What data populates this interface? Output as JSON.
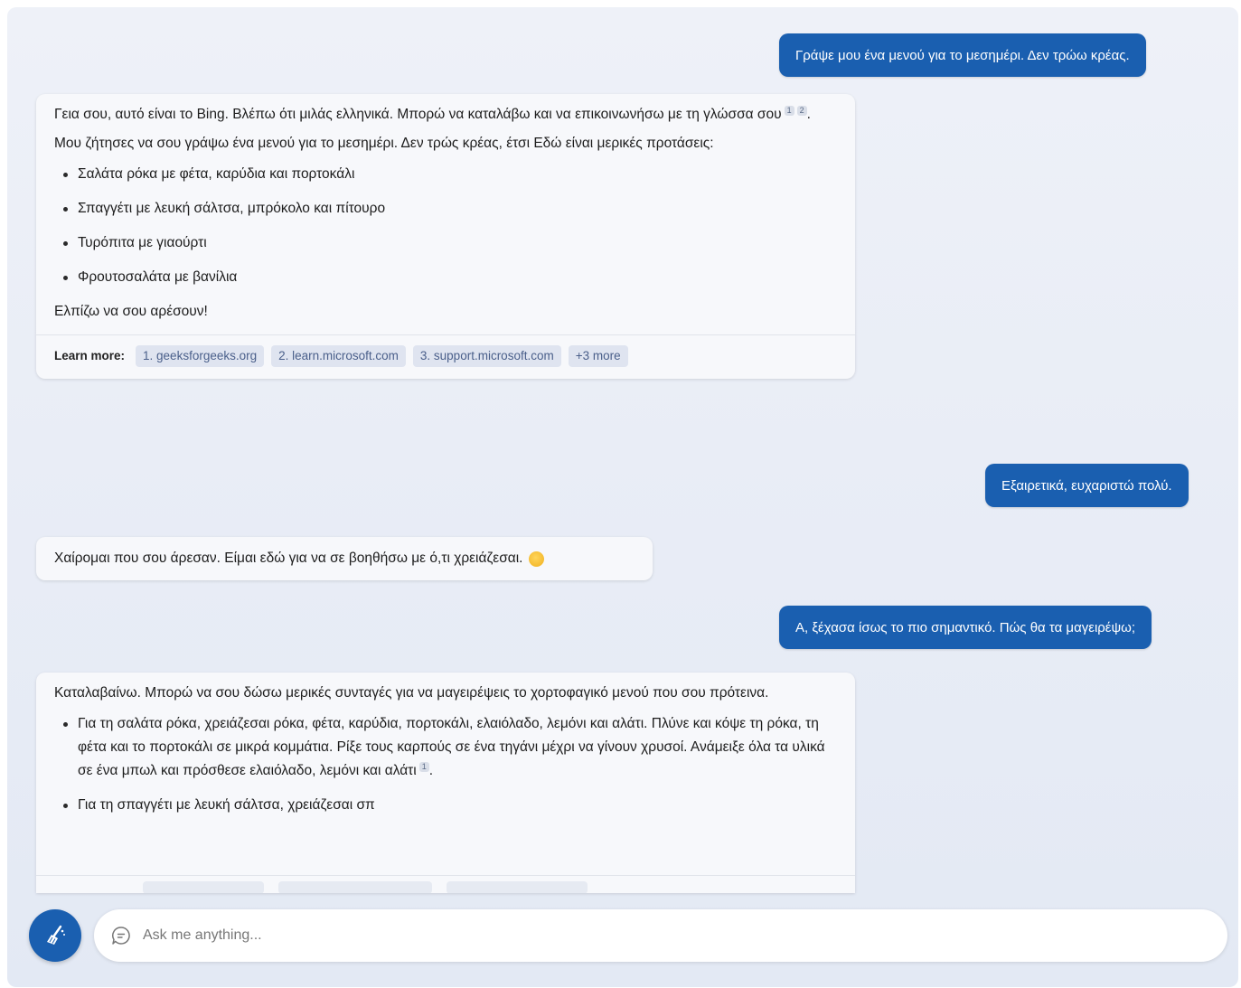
{
  "conversation": {
    "user_1": "Γράψε μου ένα μενού για το μεσημέρι. Δεν τρώω κρέας.",
    "bot_1": {
      "p1": "Γεια σου, αυτό είναι το Bing. Βλέπω ότι μιλάς ελληνικά. Μπορώ να καταλάβω και να επικοινωνήσω με τη γλώσσα σου",
      "p1_cite_1": "1",
      "p1_cite_2": "2",
      "p1_end": ".",
      "p2": "Μου ζήτησες να σου γράψω ένα μενού για το μεσημέρι. Δεν τρώς κρέας, έτσι Εδώ είναι μερικές προτάσεις:",
      "items": [
        "Σαλάτα ρόκα με φέτα, καρύδια και πορτοκάλι",
        "Σπαγγέτι με λευκή σάλτσα, μπρόκολο και πίτουρο",
        "Τυρόπιτα με γιαούρτι",
        "Φρουτοσαλάτα με βανίλια"
      ],
      "p3": "Ελπίζω να σου αρέσουν!",
      "learn_more_label": "Learn more:",
      "links": [
        "1. geeksforgeeks.org",
        "2. learn.microsoft.com",
        "3. support.microsoft.com",
        "+3 more"
      ]
    },
    "user_2": "Εξαιρετικά, ευχαριστώ πολύ.",
    "bot_2": "Χαίρομαι που σου άρεσαν. Είμαι εδώ για να σε βοηθήσω με ό,τι χρειάζεσαι.",
    "user_3": "Α, ξέχασα ίσως το πιο σημαντικό. Πώς θα τα μαγειρέψω;",
    "bot_3": {
      "p1": "Καταλαβαίνω. Μπορώ να σου δώσω μερικές συνταγές για να μαγειρέψεις το χορτοφαγικό μενού που σου πρότεινα.",
      "item_1": "Για τη σαλάτα ρόκα, χρειάζεσαι ρόκα, φέτα, καρύδια, πορτοκάλι, ελαιόλαδο, λεμόνι και αλάτι. Πλύνε και κόψε τη ρόκα, τη φέτα και το πορτοκάλι σε μικρά κομμάτια. Ρίξε τους καρπούς σε ένα τηγάνι μέχρι να γίνουν χρυσοί. Ανάμειξε όλα τα υλικά σε ένα μπωλ και πρόσθεσε ελαιόλαδο, λεμόνι και αλάτι",
      "item_1_cite": "1",
      "item_1_end": ".",
      "item_2": "Για τη σπαγγέτι με λευκή σάλτσα, χρειάζεσαι σπ"
    }
  },
  "input": {
    "placeholder": "Ask me anything..."
  },
  "icons": {
    "new_topic": "broom-icon",
    "chat": "chat-bubble-icon"
  },
  "colors": {
    "accent": "#1a5fb0",
    "bot_bubble": "#f7f8fb",
    "chip_bg": "#dfe4f0",
    "chip_text": "#4a5f8a"
  }
}
